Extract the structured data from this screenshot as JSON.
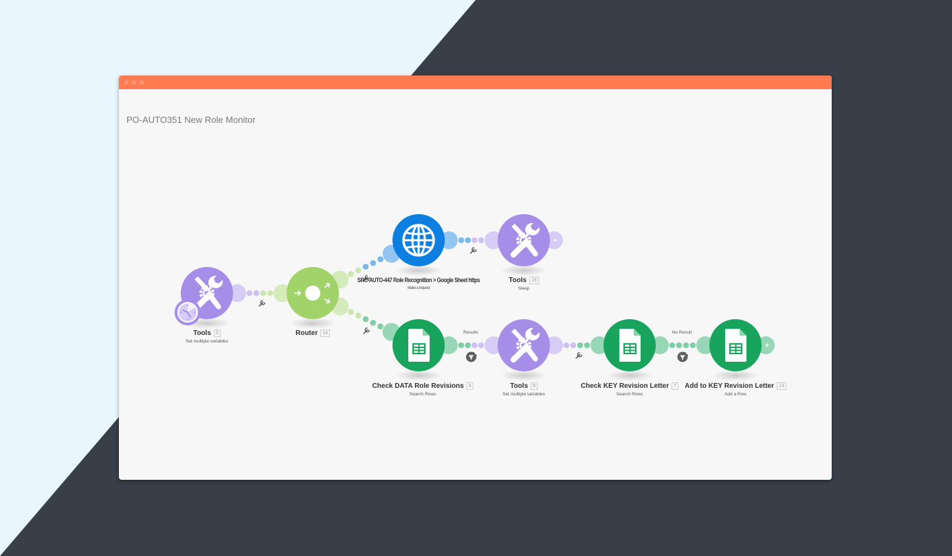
{
  "window": {
    "title": "PO-AUTO351 New Role Monitor",
    "titlebar_color": "#ff7c53"
  },
  "colors": {
    "background_light": "#e9f6fe",
    "background_dark": "#383f49",
    "tools": "#a58ee8",
    "router": "#a2d36a",
    "http": "#0c7fe0",
    "sheets": "#18a45d",
    "filter": "#5f5f5f"
  },
  "nodes": [
    {
      "id": "5",
      "app": "Tools",
      "name": "Tools",
      "action": "Set multiple variables",
      "icon": "tools-icon",
      "trigger": true
    },
    {
      "id": "14",
      "app": "Router",
      "name": "Router",
      "action": "",
      "icon": "router-icon"
    },
    {
      "id": "",
      "app": "HTTP",
      "name": "SRC-AUTO-447 Role Recognition > Google Sheet https",
      "action": "Make a request",
      "icon": "globe-icon"
    },
    {
      "id": "16",
      "app": "Tools",
      "name": "Tools",
      "action": "Sleep",
      "icon": "tools-icon",
      "prefix_id": "1"
    },
    {
      "id": "4",
      "app": "Google Sheets",
      "name": "Check DATA Role Revisions",
      "action": "Search Rows",
      "icon": "sheets-icon"
    },
    {
      "id": "9",
      "app": "Tools",
      "name": "Tools",
      "action": "Set multiple variables",
      "icon": "tools-icon"
    },
    {
      "id": "7",
      "app": "Google Sheets",
      "name": "Check KEY Revision Letter",
      "action": "Search Rows",
      "icon": "sheets-icon"
    },
    {
      "id": "13",
      "app": "Google Sheets",
      "name": "Add to KEY Revision Letter",
      "action": "Add a Row",
      "icon": "sheets-icon"
    }
  ],
  "routes": [
    {
      "from": "Tools 5",
      "to": "Router 14",
      "label": ""
    },
    {
      "from": "Router 14",
      "to": "HTTP",
      "label": ""
    },
    {
      "from": "HTTP",
      "to": "Tools 16",
      "label": ""
    },
    {
      "from": "Router 14",
      "to": "Check DATA Role Revisions 4",
      "label": ""
    },
    {
      "from": "Check DATA Role Revisions 4",
      "to": "Tools 9",
      "label": "Results",
      "filter": true
    },
    {
      "from": "Tools 9",
      "to": "Check KEY Revision Letter 7",
      "label": ""
    },
    {
      "from": "Check KEY Revision Letter 7",
      "to": "Add to KEY Revision Letter 13",
      "label": "No Result",
      "filter": true
    }
  ]
}
